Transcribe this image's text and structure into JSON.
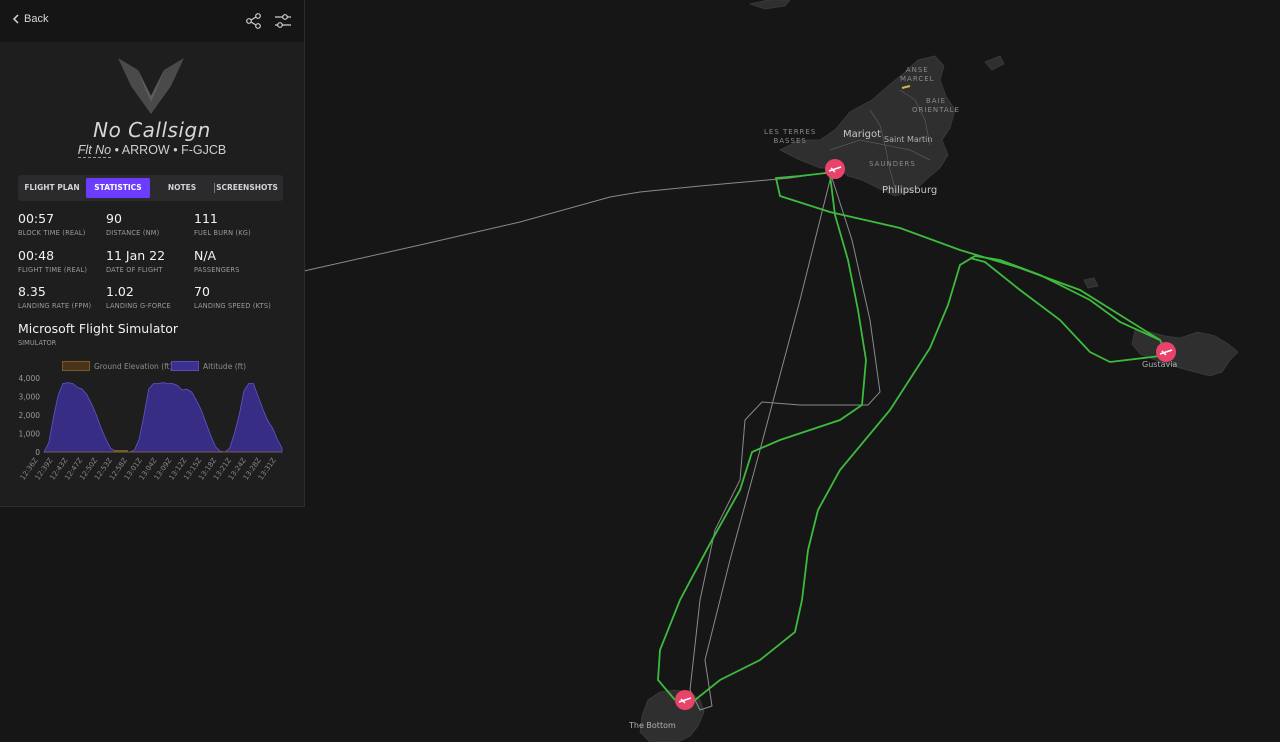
{
  "topbar": {
    "back_label": "Back",
    "share_icon": "share-icon",
    "settings_icon": "sliders-icon"
  },
  "flight": {
    "callsign": "No Callsign",
    "flt_no_label": "Flt No",
    "separator": "•",
    "aircraft": "ARROW",
    "registration": "F-GJCB"
  },
  "tabs": [
    {
      "label": "FLIGHT PLAN",
      "active": false
    },
    {
      "label": "STATISTICS",
      "active": true
    },
    {
      "label": "NOTES",
      "active": false
    },
    {
      "label": "SCREENSHOTS",
      "active": false
    }
  ],
  "stats": [
    {
      "value": "00:57",
      "label": "BLOCK TIME (REAL)"
    },
    {
      "value": "90",
      "label": "DISTANCE (NM)"
    },
    {
      "value": "111",
      "label": "FUEL BURN (KG)"
    },
    {
      "value": "00:48",
      "label": "FLIGHT TIME (REAL)"
    },
    {
      "value": "11 Jan 22",
      "label": "DATE OF FLIGHT"
    },
    {
      "value": "N/A",
      "label": "PASSENGERS"
    },
    {
      "value": "8.35",
      "label": "LANDING RATE (FPM)"
    },
    {
      "value": "1.02",
      "label": "LANDING G-FORCE"
    },
    {
      "value": "70",
      "label": "LANDING SPEED (KTS)"
    }
  ],
  "simulator": {
    "name": "Microsoft Flight Simulator",
    "label": "SIMULATOR"
  },
  "chart_data": {
    "type": "area",
    "series": [
      {
        "name": "Ground Elevation (ft)",
        "color": "#6b4a1e",
        "values": [
          0,
          0,
          0,
          0,
          0,
          0,
          0,
          0,
          0,
          0,
          0,
          0,
          0,
          0,
          0,
          0,
          0,
          0,
          0,
          0,
          0,
          0,
          0,
          0,
          0,
          0,
          0,
          0,
          0,
          0,
          0,
          0,
          0,
          0,
          0,
          0,
          0,
          0,
          0,
          0,
          0,
          0,
          0,
          0,
          0,
          0,
          0,
          0,
          0,
          0,
          0,
          0,
          0,
          0,
          0,
          0,
          0,
          0,
          0,
          0,
          0,
          0,
          0,
          0,
          0,
          0,
          0,
          0,
          0,
          0,
          0,
          0,
          0,
          0,
          0,
          0,
          0,
          0,
          0,
          0,
          0
        ]
      },
      {
        "name": "Altitude (ft)",
        "color": "#3b2f8f",
        "values": [
          0,
          500,
          1900,
          3100,
          3700,
          3750,
          3700,
          3500,
          3400,
          3100,
          2600,
          2000,
          1300,
          700,
          200,
          50,
          0,
          0,
          0,
          100,
          700,
          2000,
          3400,
          3700,
          3700,
          3750,
          3700,
          3700,
          3600,
          3350,
          3400,
          3250,
          2800,
          2300,
          1600,
          900,
          300,
          50,
          0,
          200,
          1000,
          2000,
          3300,
          3700,
          3700,
          3000,
          2300,
          1700,
          1300,
          700,
          200
        ]
      }
    ],
    "x_ticks": [
      "12:36Z",
      "12:39Z",
      "12:43Z",
      "12:47Z",
      "12:50Z",
      "12:53Z",
      "12:58Z",
      "13:01Z",
      "13:04Z",
      "13:09Z",
      "13:12Z",
      "13:15Z",
      "13:18Z",
      "13:21Z",
      "13:24Z",
      "13:28Z",
      "13:31Z"
    ],
    "y_ticks": [
      "4,000",
      "3,000",
      "2,000",
      "1,000",
      "0"
    ],
    "ylim": [
      0,
      4000
    ],
    "legend_position": "top"
  },
  "map": {
    "labels": {
      "anse_marcel": "ANSE\nMARCEL",
      "baie_orientale": "BAIE\nORIENTALE",
      "les_terres_basses": "LES TERRES\nBASSES",
      "marigot": "Marigot",
      "saint_martin": "Saint Martin",
      "saunders": "SAUNDERS",
      "philipsburg": "Philipsburg",
      "gustavia": "Gustavia",
      "the_bottom": "The Bottom"
    },
    "route_color": "#3dbb3d",
    "track_color": "#8a8a8a",
    "airport_marker_color": "#e8436a"
  }
}
